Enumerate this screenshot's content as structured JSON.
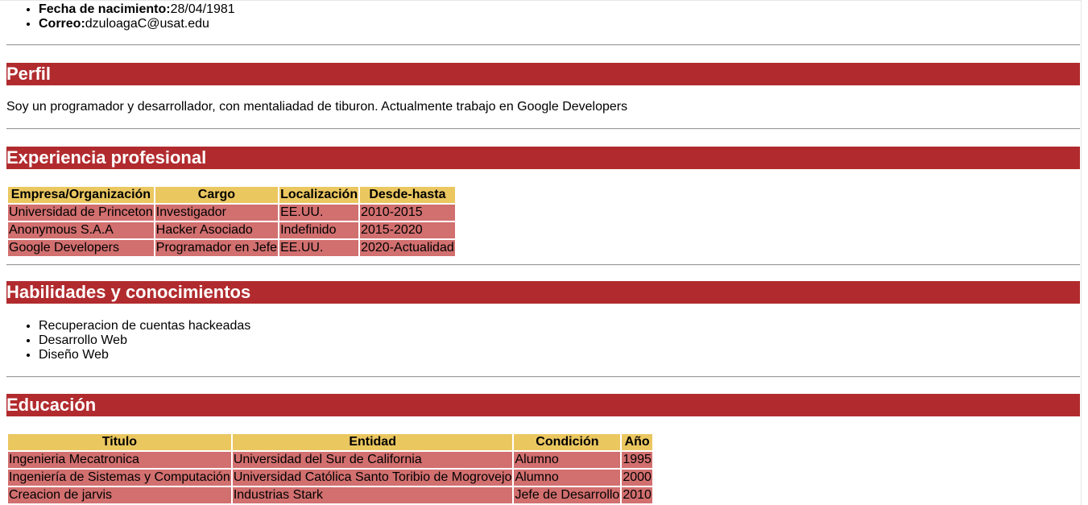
{
  "contact": [
    {
      "label": "Fecha de nacimiento:",
      "value": "28/04/1981"
    },
    {
      "label": "Correo:",
      "value": "dzuloagaC@usat.edu"
    }
  ],
  "profile": {
    "title": "Perfil",
    "text": "Soy un programador y desarrollador, con mentaliadad de tiburon. Actualmente trabajo en Google Developers"
  },
  "experience": {
    "title": "Experiencia profesional",
    "headers": [
      "Empresa/Organización",
      "Cargo",
      "Localización",
      "Desde-hasta"
    ],
    "rows": [
      [
        "Universidad de Princeton",
        "Investigador",
        "EE.UU.",
        "2010-2015"
      ],
      [
        "Anonymous S.A.A",
        "Hacker Asociado",
        "Indefinido",
        "2015-2020"
      ],
      [
        "Google Developers",
        "Programador en Jefe",
        "EE.UU.",
        "2020-Actualidad"
      ]
    ]
  },
  "skills": {
    "title": "Habilidades y conocimientos",
    "items": [
      "Recuperacion de cuentas hackeadas",
      "Desarrollo Web",
      "Diseño Web"
    ]
  },
  "education": {
    "title": "Educación",
    "headers": [
      "Titulo",
      "Entidad",
      "Condición",
      "Año"
    ],
    "rows": [
      [
        "Ingenieria Mecatronica",
        "Universidad del Sur de California",
        "Alumno",
        "1995"
      ],
      [
        "Ingeniería de Sistemas y Computación",
        "Universidad Católica Santo Toribio de Mogrovejo",
        "Alumno",
        "2000"
      ],
      [
        "Creacion de jarvis",
        "Industrias Stark",
        "Jefe de Desarrollo",
        "2010"
      ]
    ]
  },
  "colors": {
    "section_bg": "#b12b2e",
    "header_cell_bg": "#ebc760",
    "data_cell_bg": "#d26f6f"
  }
}
